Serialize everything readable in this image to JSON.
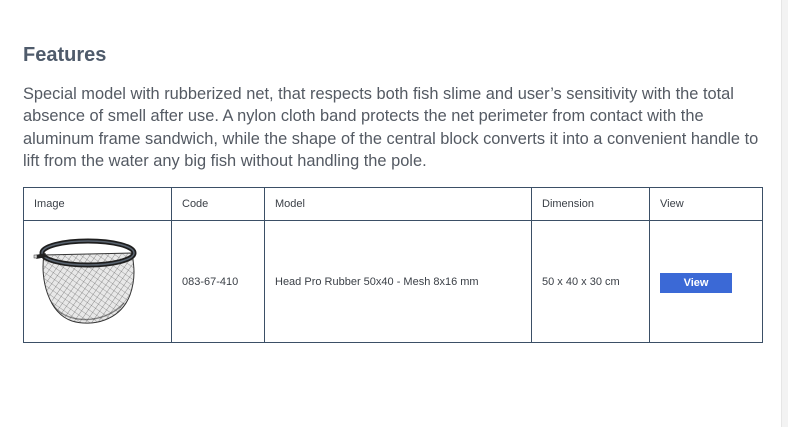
{
  "features": {
    "title": "Features",
    "text": "Special model with rubberized net, that respects both fish slime and user’s sensitivity with the total absence of smell after use. A nylon cloth band protects the net perimeter from contact with the aluminum frame sandwich, while the shape of the central block converts it into a convenient handle to lift from the water any big fish without handling the pole."
  },
  "table": {
    "headers": {
      "image": "Image",
      "code": "Code",
      "model": "Model",
      "dimension": "Dimension",
      "view": "View"
    },
    "rows": [
      {
        "image_icon": "landing-net-head",
        "code": "083-67-410",
        "model": "Head Pro Rubber 50x40 - Mesh 8x16 mm",
        "dimension": "50 x 40 x 30 cm",
        "view_label": "View"
      }
    ]
  },
  "colors": {
    "heading": "#4f5b6b",
    "text": "#545a63",
    "table_border": "#3b4f66",
    "button": "#3b69d6"
  }
}
